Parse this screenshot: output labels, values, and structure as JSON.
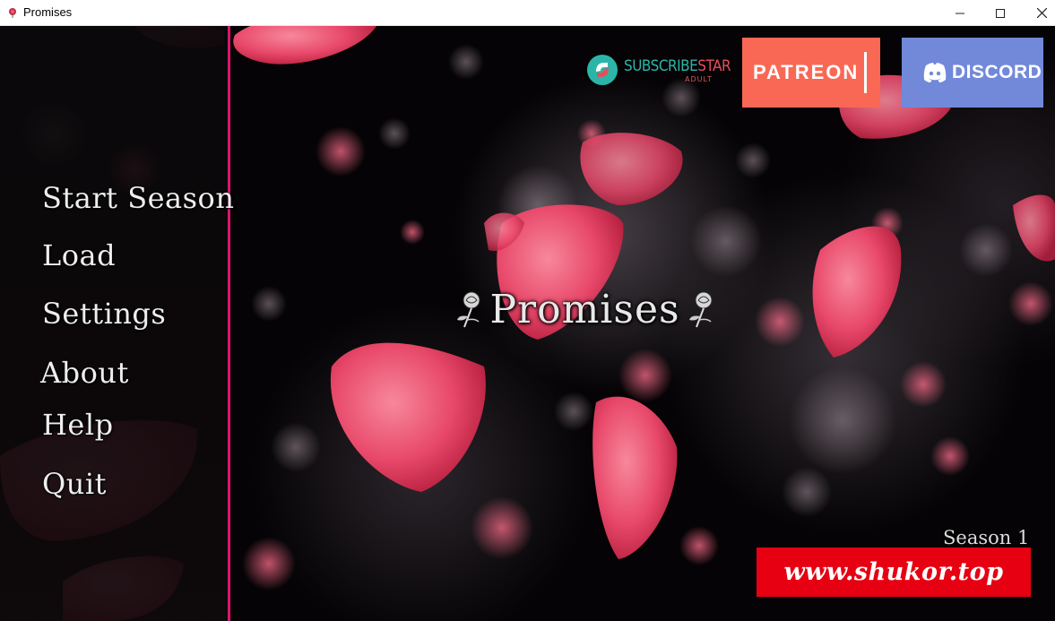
{
  "window": {
    "title": "Promises",
    "app_icon": "rose-app-icon",
    "controls": [
      "minimize-icon",
      "maximize-icon",
      "close-icon"
    ]
  },
  "game": {
    "title": "Promises",
    "season_label": "Season 1",
    "watermark": "www.shukor.top"
  },
  "menu": {
    "items": [
      {
        "label": "Start Season"
      },
      {
        "label": "Load"
      },
      {
        "label": "Settings"
      },
      {
        "label": "About"
      },
      {
        "label": "Help"
      },
      {
        "label": "Quit"
      }
    ]
  },
  "social": {
    "subscribestar": {
      "label_a": "SUBSCRIBE",
      "label_b": "STAR",
      "sub_label": "ADULT"
    },
    "patreon": {
      "label": "PATREON"
    },
    "discord": {
      "label": "DISCORD"
    }
  },
  "colors": {
    "sidebar_accent": "#e0136c",
    "patreon": "#f96854",
    "discord": "#7289da",
    "watermark": "#e60012",
    "petal": "#e84a6a"
  }
}
